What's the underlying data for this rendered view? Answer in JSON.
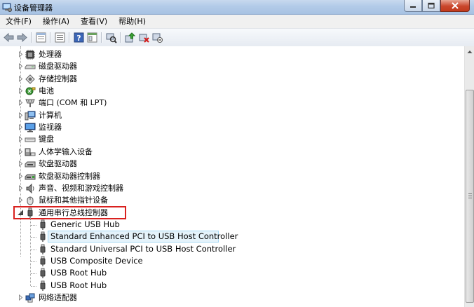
{
  "window": {
    "title": "设备管理器"
  },
  "menu": [
    "文件(F)",
    "操作(A)",
    "查看(V)",
    "帮助(H)"
  ],
  "toolbar": {
    "icons": [
      "back-icon",
      "forward-icon",
      "properties-icon",
      "console-tree-icon",
      "help-icon",
      "show-hide-icon",
      "scan-hardware-icon",
      "update-driver-icon",
      "uninstall-icon",
      "disable-icon"
    ]
  },
  "tree": {
    "categories": [
      {
        "label": "处理器",
        "icon": "processor-icon"
      },
      {
        "label": "磁盘驱动器",
        "icon": "disk-drive-icon"
      },
      {
        "label": "存储控制器",
        "icon": "storage-controller-icon"
      },
      {
        "label": "电池",
        "icon": "battery-icon"
      },
      {
        "label": "端口 (COM 和 LPT)",
        "icon": "port-icon"
      },
      {
        "label": "计算机",
        "icon": "computer-icon"
      },
      {
        "label": "监视器",
        "icon": "monitor-icon"
      },
      {
        "label": "键盘",
        "icon": "keyboard-icon"
      },
      {
        "label": "人体学输入设备",
        "icon": "hid-icon"
      },
      {
        "label": "软盘驱动器",
        "icon": "floppy-drive-icon"
      },
      {
        "label": "软盘驱动器控制器",
        "icon": "floppy-controller-icon"
      },
      {
        "label": "声音、视频和游戏控制器",
        "icon": "sound-icon"
      },
      {
        "label": "鼠标和其他指针设备",
        "icon": "mouse-icon"
      }
    ],
    "usb": {
      "label": "通用串行总线控制器",
      "icon": "usb-icon",
      "highlight_color": "#d9211f",
      "children": [
        "Generic USB Hub",
        "Standard Enhanced PCI to USB Host Controller",
        "Standard Universal PCI to USB Host Controller",
        "USB Composite Device",
        "USB Root Hub",
        "USB Root Hub"
      ],
      "selected_child": "Standard Enhanced PCI to USB Host Controller"
    },
    "last": {
      "label": "网络适配器",
      "icon": "network-adapter-icon"
    }
  },
  "colors": {
    "selection_bg": "#e5f3fb",
    "selection_border": "#a6d8f4",
    "titlebar": "#b3cbe8"
  }
}
